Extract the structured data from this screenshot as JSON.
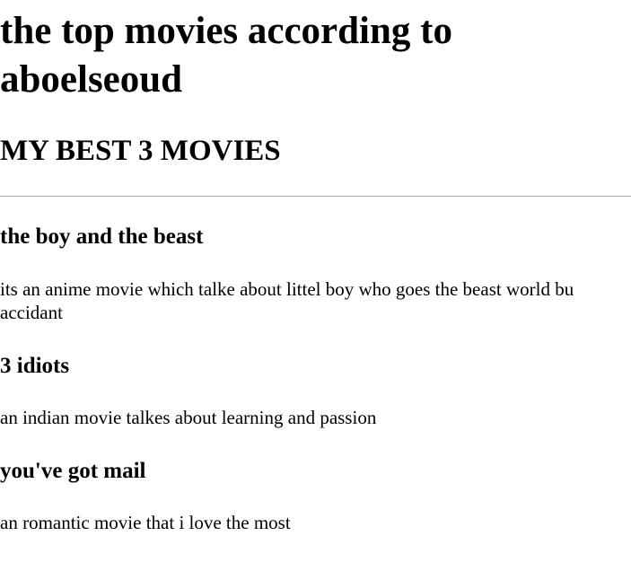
{
  "page": {
    "title": "the top movies according to aboelseoud",
    "subtitle": "MY BEST 3 MOVIES"
  },
  "movies": [
    {
      "name": "the boy and the beast",
      "description": "its an anime movie which talke about littel boy who goes the beast world bu accidant"
    },
    {
      "name": "3 idiots",
      "description": "an indian movie talkes about learning and passion"
    },
    {
      "name": "you've got mail",
      "description": "an romantic movie that i love the most"
    }
  ]
}
